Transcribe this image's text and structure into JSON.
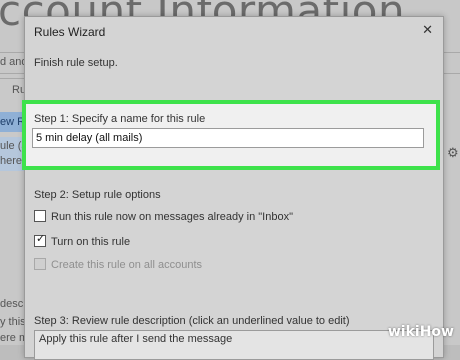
{
  "background": {
    "title": "ccount Information",
    "bar_text": "d and A",
    "rules_tab": "Rules",
    "new_rule": "ew Rul",
    "rule_line1": "ule (a",
    "rule_line2": "here m",
    "bottom_lines": [
      "descri",
      "y this",
      "ere my"
    ]
  },
  "dialog": {
    "title": "Rules Wizard",
    "close_glyph": "✕",
    "subtitle": "Finish rule setup.",
    "step1": {
      "label": "Step 1: Specify a name for this rule",
      "value": "5 min delay (all mails)"
    },
    "step2": {
      "label": "Step 2: Setup rule options",
      "options": [
        {
          "label": "Run this rule now on messages already in \"Inbox\"",
          "checked": false,
          "disabled": false
        },
        {
          "label": "Turn on this rule",
          "checked": true,
          "disabled": false
        },
        {
          "label": "Create this rule on all accounts",
          "checked": false,
          "disabled": true
        }
      ]
    },
    "step3": {
      "label": "Step 3: Review rule description (click an underlined value to edit)",
      "description": "Apply this rule after I send the message"
    }
  },
  "watermark": {
    "wiki": "wiki",
    "how": "How"
  },
  "colors": {
    "highlight": "#3ee24b",
    "dialog_bg": "#d4d4d4"
  }
}
